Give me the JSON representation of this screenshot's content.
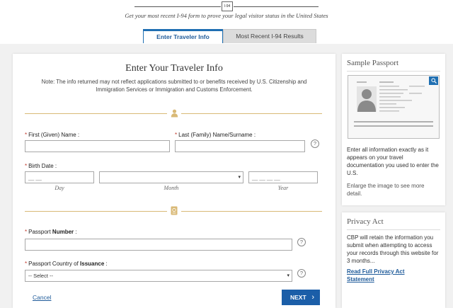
{
  "header": {
    "logo_text": "I-94",
    "subtitle": "Get your most recent I-94 form to prove your legal visitor status in the United States"
  },
  "tabs": [
    {
      "label": "Enter Traveler Info",
      "active": true
    },
    {
      "label": "Most Recent I-94 Results",
      "active": false
    }
  ],
  "form": {
    "title": "Enter Your Traveler Info",
    "note": "Note: The info returned may not reflect applications submitted to or benefits received by U.S. Citizenship and Immigration Services or Immigration and Customs Enforcement.",
    "required_mark": "*",
    "first_name_label": "First (Given) Name :",
    "last_name_label": "Last (Family) Name/Surname :",
    "birth_date_label": "Birth Date :",
    "day_placeholder": "__ __",
    "year_placeholder": "__ __ __ __",
    "day_label": "Day",
    "month_label": "Month",
    "year_label": "Year",
    "passport_number_label_pre": "Passport ",
    "passport_number_label_bold": "Number",
    "passport_number_label_post": " :",
    "passport_country_label_pre": "Passport Country of ",
    "passport_country_label_bold": "Issuance",
    "passport_country_label_post": " :",
    "country_selected": "-- Select --",
    "help_glyph": "?",
    "cancel_label": "Cancel",
    "next_label": "NEXT",
    "next_chevron": "›"
  },
  "sample_panel": {
    "title": "Sample Passport",
    "text1": "Enter all information exactly as it appears on your travel documentation you used to enter the U.S.",
    "text2": "Enlarge the image to see more detail."
  },
  "privacy_panel": {
    "title": "Privacy Act",
    "text": "CBP will retain the information you submit when attempting to access your records through this website for 3 months...",
    "link": "Read Full Privacy Act Statement"
  },
  "colors": {
    "accent_blue": "#1b5ea8",
    "gold_divider": "#d9b976",
    "required_red": "#c0392b"
  },
  "icons": [
    "person-icon",
    "passport-icon",
    "help-icon",
    "zoom-icon",
    "chevron-right-icon",
    "dropdown-arrow-icon"
  ]
}
